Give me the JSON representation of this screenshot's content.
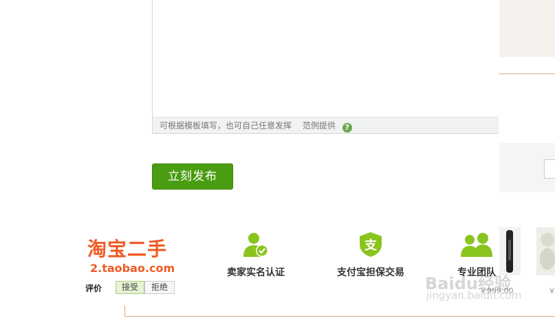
{
  "editor": {
    "hint": "可根据模板填写，也可自己任意发挥",
    "example_link": "范例提供",
    "help_glyph": "?"
  },
  "publish_button": "立刻发布",
  "logo": {
    "cn": "淘宝二手",
    "en": "2.taobao.com",
    "color": "#f05a23"
  },
  "features": [
    {
      "label": "卖家实名认证",
      "icon": "verified-user-icon"
    },
    {
      "label": "支付宝担保交易",
      "icon": "alipay-shield-icon",
      "glyph": "支"
    },
    {
      "label": "专业团队",
      "icon": "team-icon"
    }
  ],
  "evaluation": {
    "label": "评价",
    "accept": "接受",
    "reject": "拒绝"
  },
  "products": [
    {
      "price": "￥999.00"
    },
    {
      "price": "￥"
    }
  ],
  "watermark": {
    "text": "Baidu经验",
    "sub": "jingyan.baidu.com"
  },
  "colors": {
    "accent_green": "#4a9d12",
    "icon_green": "#8ac41e",
    "divider": "#dca37b"
  }
}
